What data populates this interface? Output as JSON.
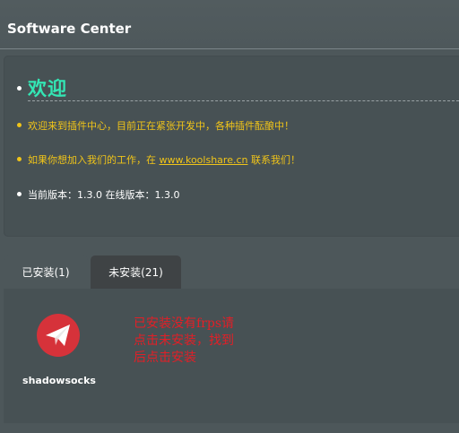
{
  "header": {
    "title": "Software Center"
  },
  "welcome": {
    "title": "欢迎",
    "notice_1": "欢迎来到插件中心，目前正在紧张开发中，各种插件酝酿中！",
    "notice_2_before": "如果你想加入我们的工作，在 ",
    "notice_2_link": "www.koolshare.cn",
    "notice_2_after": " 联系我们！",
    "version_line": "当前版本：1.3.0 在线版本：1.3.0"
  },
  "tabs": [
    {
      "label": "已安装(1)",
      "active": true
    },
    {
      "label": "未安装(21)",
      "active": false
    }
  ],
  "installed_plugins": [
    {
      "name": "shadowsocks",
      "icon": "paper-plane-icon",
      "icon_color": "#d6323a"
    }
  ],
  "annotation": {
    "lines": [
      "已安装没有frps请",
      "点击未安装，找到",
      "后点击安装"
    ]
  },
  "colors": {
    "accent_green": "#33e6b4",
    "notice_yellow": "#f0c419",
    "annotation_red": "#e41e26",
    "panel_bg": "#475154"
  }
}
